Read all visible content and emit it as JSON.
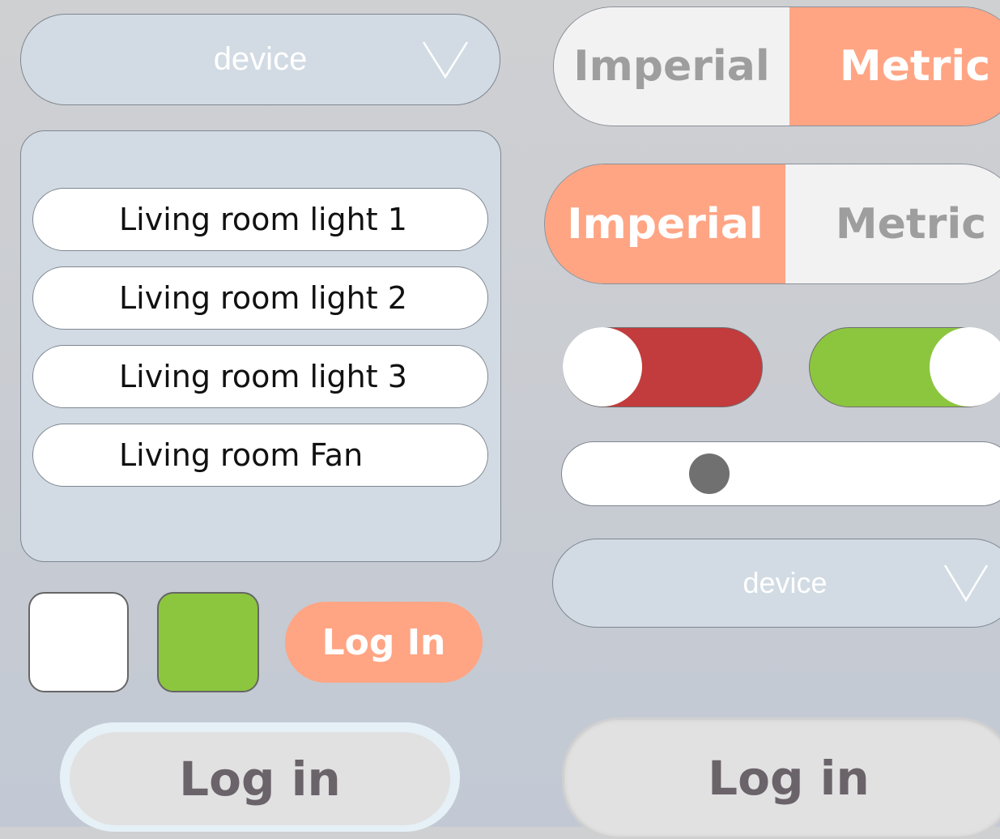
{
  "dropdown_top": {
    "placeholder": "device",
    "icon": "chevron-down-icon"
  },
  "device_list": {
    "items": [
      {
        "label": "Living room light 1"
      },
      {
        "label": "Living room light 2"
      },
      {
        "label": "Living room light 3"
      },
      {
        "label": "Living room Fan"
      }
    ]
  },
  "checkbox_unchecked": {
    "checked": false
  },
  "checkbox_checked": {
    "checked": true,
    "color": "#8cc63f"
  },
  "login_orange": {
    "label": "Log In",
    "color": "#ffa584"
  },
  "login_outlined": {
    "label": "Log in"
  },
  "unit_toggle_metric": {
    "options": [
      "Imperial",
      "Metric"
    ],
    "selected": "Metric"
  },
  "unit_toggle_imperial": {
    "options": [
      "Imperial",
      "Metric"
    ],
    "selected": "Imperial"
  },
  "switch_off": {
    "state": "off",
    "color": "#c23b3d"
  },
  "switch_on": {
    "state": "on",
    "color": "#8cc63f"
  },
  "slider": {
    "value": 0.33
  },
  "dropdown_bottom": {
    "placeholder": "device",
    "icon": "chevron-down-icon"
  },
  "login_plain": {
    "label": "Log in"
  }
}
